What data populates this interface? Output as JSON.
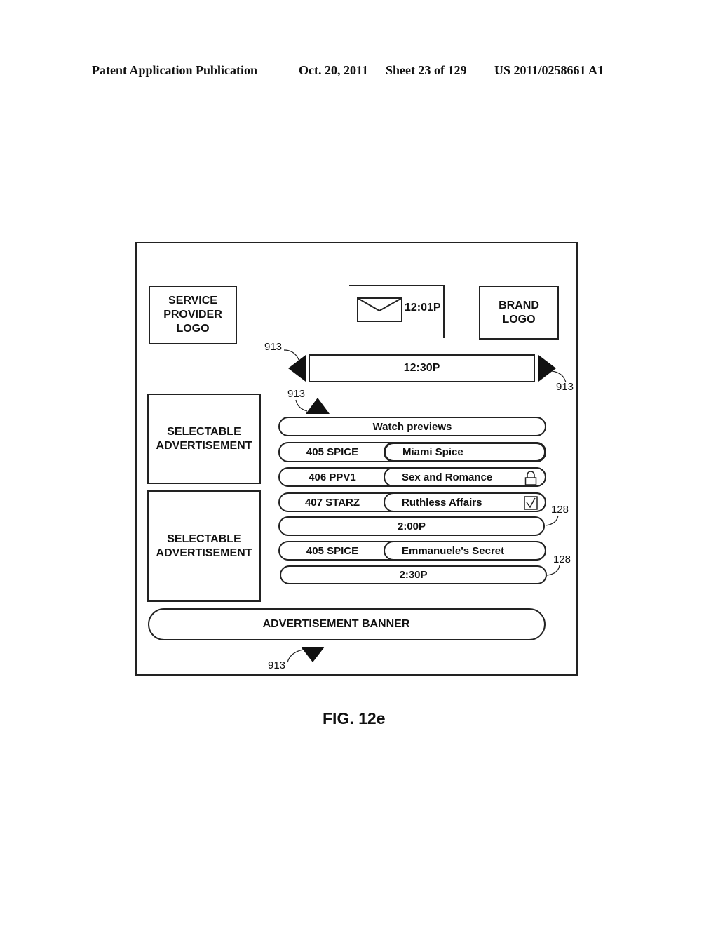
{
  "header": {
    "publication": "Patent Application Publication",
    "date": "Oct. 20, 2011",
    "sheet": "Sheet 23 of 129",
    "number": "US 2011/0258661 A1"
  },
  "screen": {
    "service_provider_logo": "SERVICE PROVIDER LOGO",
    "brand_logo": "BRAND LOGO",
    "clock": "12:01P",
    "mail_icon": "envelope-icon",
    "time_nav": "12:30P",
    "selectable_ads": [
      "SELECTABLE ADVERTISEMENT",
      "SELECTABLE ADVERTISEMENT"
    ],
    "watch_previews": "Watch previews",
    "listings": [
      {
        "channel": "405 SPICE",
        "program": "Miami Spice",
        "selected": true,
        "icon": ""
      },
      {
        "channel": "406 PPV1",
        "program": "Sex and Romance",
        "selected": false,
        "icon": "lock-icon"
      },
      {
        "channel": "407 STARZ",
        "program": "Ruthless Affairs",
        "selected": false,
        "icon": "checkbox-checked-icon"
      },
      {
        "time": "2:00P"
      },
      {
        "channel": "405 SPICE",
        "program": "Emmanuele's Secret",
        "selected": false,
        "icon": ""
      },
      {
        "time": "2:30P"
      }
    ],
    "ad_banner": "ADVERTISEMENT BANNER"
  },
  "refs": {
    "left_arrow": "913",
    "right_arrow": "913",
    "up_arrow": "913",
    "down_arrow": "913",
    "row_128a": "128",
    "row_128b": "128"
  },
  "caption": "FIG. 12e"
}
